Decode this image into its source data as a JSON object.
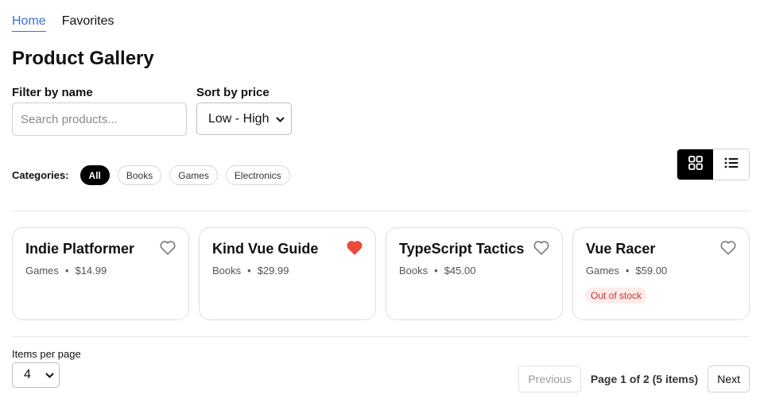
{
  "nav": {
    "home": "Home",
    "favorites": "Favorites"
  },
  "page_title": "Product Gallery",
  "filter": {
    "label": "Filter by name",
    "placeholder": "Search products..."
  },
  "sort": {
    "label": "Sort by price",
    "selected": "Low - High"
  },
  "categories": {
    "label": "Categories:",
    "items": [
      "All",
      "Books",
      "Games",
      "Electronics"
    ],
    "active": "All"
  },
  "view_toggle": {
    "active": "grid",
    "icons": [
      "grid-icon",
      "list-icon"
    ]
  },
  "products": [
    {
      "name": "Indie Platformer",
      "category": "Games",
      "price": "$14.99",
      "favorite": false,
      "stock_badge": ""
    },
    {
      "name": "Kind Vue Guide",
      "category": "Books",
      "price": "$29.99",
      "favorite": true,
      "stock_badge": ""
    },
    {
      "name": "TypeScript Tactics",
      "category": "Books",
      "price": "$45.00",
      "favorite": false,
      "stock_badge": ""
    },
    {
      "name": "Vue Racer",
      "category": "Games",
      "price": "$59.00",
      "favorite": false,
      "stock_badge": "Out of stock"
    }
  ],
  "meta_separator": "•",
  "items_per_page": {
    "label": "Items per page",
    "selected": "4"
  },
  "pagination": {
    "previous": "Previous",
    "info": "Page 1 of 2 (5 items)",
    "next": "Next"
  },
  "colors": {
    "accent": "#3b6fd4",
    "favorite": "#e74c3c",
    "out_of_stock_bg": "#fdeceb",
    "out_of_stock_text": "#c0392b"
  }
}
